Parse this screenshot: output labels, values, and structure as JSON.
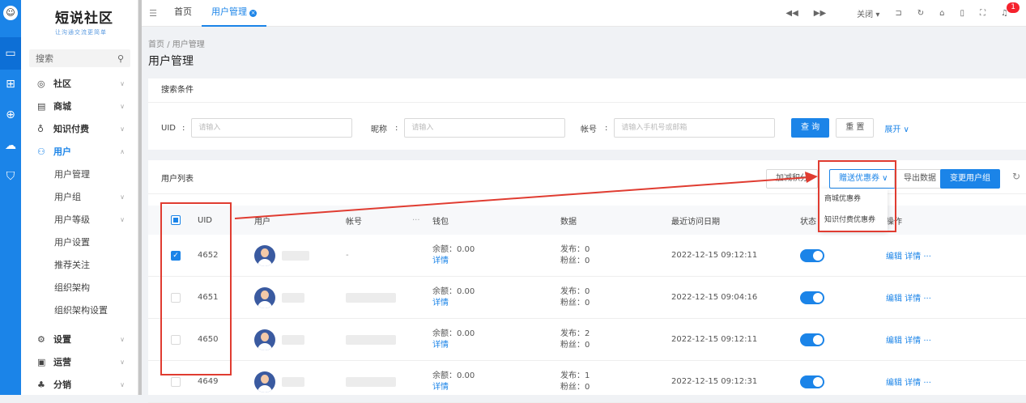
{
  "rail": {
    "icons": [
      "user-avatar-icon",
      "monitor-icon",
      "grid-icon",
      "globe-icon",
      "cloud-icon",
      "shield-icon"
    ],
    "brand_color": "#1b84e8"
  },
  "brand": {
    "title": "短说社区",
    "slogan": "让沟通交流更简单"
  },
  "sidebar": {
    "search_label": "搜索",
    "items": [
      {
        "label": "社区",
        "icon": "chat-icon"
      },
      {
        "label": "商城",
        "icon": "shop-icon"
      },
      {
        "label": "知识付费",
        "icon": "location-icon"
      },
      {
        "label": "用户",
        "icon": "users-icon"
      },
      {
        "label": "设置",
        "icon": "gear-icon"
      },
      {
        "label": "运营",
        "icon": "monitor-chart-icon"
      },
      {
        "label": "分销",
        "icon": "share-tree-icon"
      }
    ],
    "subitems": [
      "用户管理",
      "用户组",
      "用户等级",
      "用户设置",
      "推荐关注",
      "组织架构",
      "组织架构设置"
    ]
  },
  "topbar": {
    "tabs": [
      "首页",
      "用户管理"
    ],
    "close_label": "关闭",
    "notification_count": "1"
  },
  "breadcrumb": {
    "root": "首页",
    "sep": "/",
    "current": "用户管理"
  },
  "page_title": "用户管理",
  "filter": {
    "title": "搜索条件",
    "uid_label": "UID",
    "uid_placeholder": "请输入",
    "nick_label": "昵称",
    "nick_placeholder": "请输入",
    "account_label": "帐号",
    "account_placeholder": "请输入手机号或邮箱",
    "colon": ":",
    "search_btn": "查 询",
    "reset_btn": "重 置",
    "expand_btn": "展开 ∨"
  },
  "list": {
    "title": "用户列表",
    "actions": {
      "add_points": "加减积分",
      "coupon": "赠送优惠券 ∨",
      "export": "导出数据",
      "change_group": "变更用户组"
    },
    "dropdown": [
      "商城优惠券",
      "知识付费优惠券"
    ],
    "headers": {
      "uid": "UID",
      "user": "用户",
      "account": "帐号",
      "wallet": "钱包",
      "data": "数据",
      "last_visit": "最近访问日期",
      "status": "状态",
      "ops": "操作"
    },
    "rows": [
      {
        "uid": "4652",
        "checked": true,
        "account": "-",
        "balance": "余额：0.00",
        "detail": "详情",
        "posts": "发布：0",
        "fans": "粉丝：0",
        "last_visit": "2022-12-15 09:12:11",
        "ops": "编辑 详情 ···"
      },
      {
        "uid": "4651",
        "checked": false,
        "account": "",
        "balance": "余额：0.00",
        "detail": "详情",
        "posts": "发布：0",
        "fans": "粉丝：0",
        "last_visit": "2022-12-15 09:04:16",
        "ops": "编辑 详情 ···"
      },
      {
        "uid": "4650",
        "checked": false,
        "account": "",
        "balance": "余额：0.00",
        "detail": "详情",
        "posts": "发布：2",
        "fans": "粉丝：0",
        "last_visit": "2022-12-15 09:12:11",
        "ops": "编辑 详情 ···"
      },
      {
        "uid": "4649",
        "checked": false,
        "account": "",
        "balance": "余额：0.00",
        "detail": "详情",
        "posts": "发布：1",
        "fans": "粉丝：0",
        "last_visit": "2022-12-15 09:12:31",
        "ops": "编辑 详情 ···"
      }
    ]
  },
  "annotation_color": "#e03c31"
}
